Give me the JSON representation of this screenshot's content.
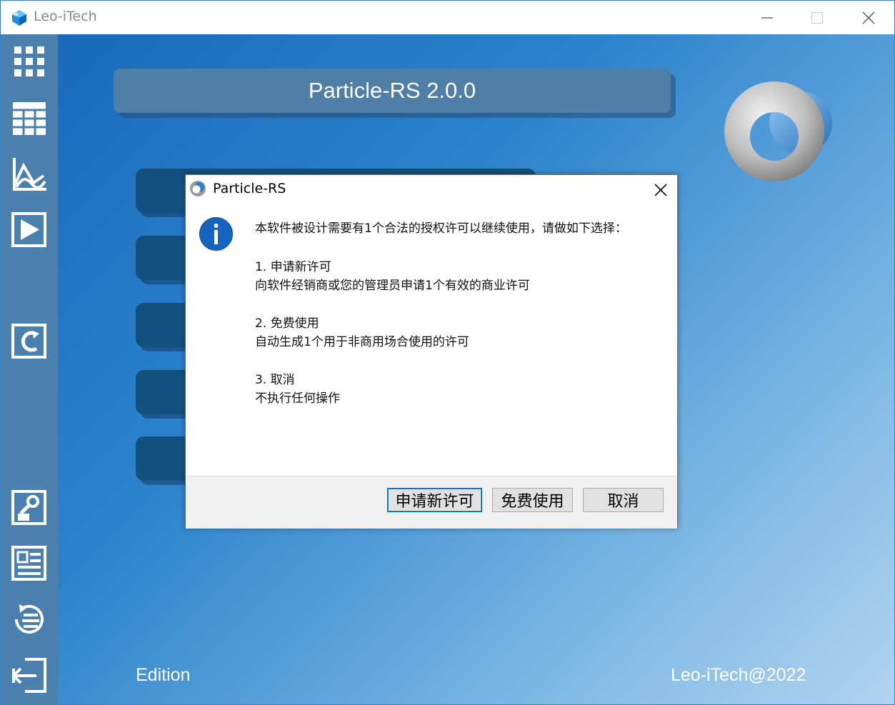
{
  "window": {
    "title": "Leo-iTech"
  },
  "main": {
    "banner_title": "Particle-RS 2.0.0",
    "edition_label": "Edition",
    "copyright": "Leo-iTech@2022"
  },
  "sidebar": {
    "items": [
      {
        "icon": "grid-icon"
      },
      {
        "icon": "table-icon"
      },
      {
        "icon": "chart-icon"
      },
      {
        "icon": "play-icon"
      },
      {
        "icon": "refresh-icon"
      },
      {
        "icon": "image-search-icon"
      },
      {
        "icon": "report-icon"
      },
      {
        "icon": "list-icon"
      },
      {
        "icon": "exit-icon"
      }
    ]
  },
  "dialog": {
    "title": "Particle-RS",
    "intro": "本软件被设计需要有1个合法的授权许可以继续使用，请做如下选择：",
    "options": [
      {
        "heading": "1. 申请新许可",
        "desc": "向软件经销商或您的管理员申请1个有效的商业许可"
      },
      {
        "heading": "2. 免费使用",
        "desc": "自动生成1个用于非商用场合使用的许可"
      },
      {
        "heading": "3. 取消",
        "desc": "不执行任何操作"
      }
    ],
    "buttons": {
      "apply": "申请新许可",
      "free": "免费使用",
      "cancel": "取消"
    }
  },
  "colors": {
    "sidebar": "#4a7fae",
    "banner": "#4f7ea7",
    "menu_slot": "#14507f",
    "accent": "#0078d7"
  }
}
